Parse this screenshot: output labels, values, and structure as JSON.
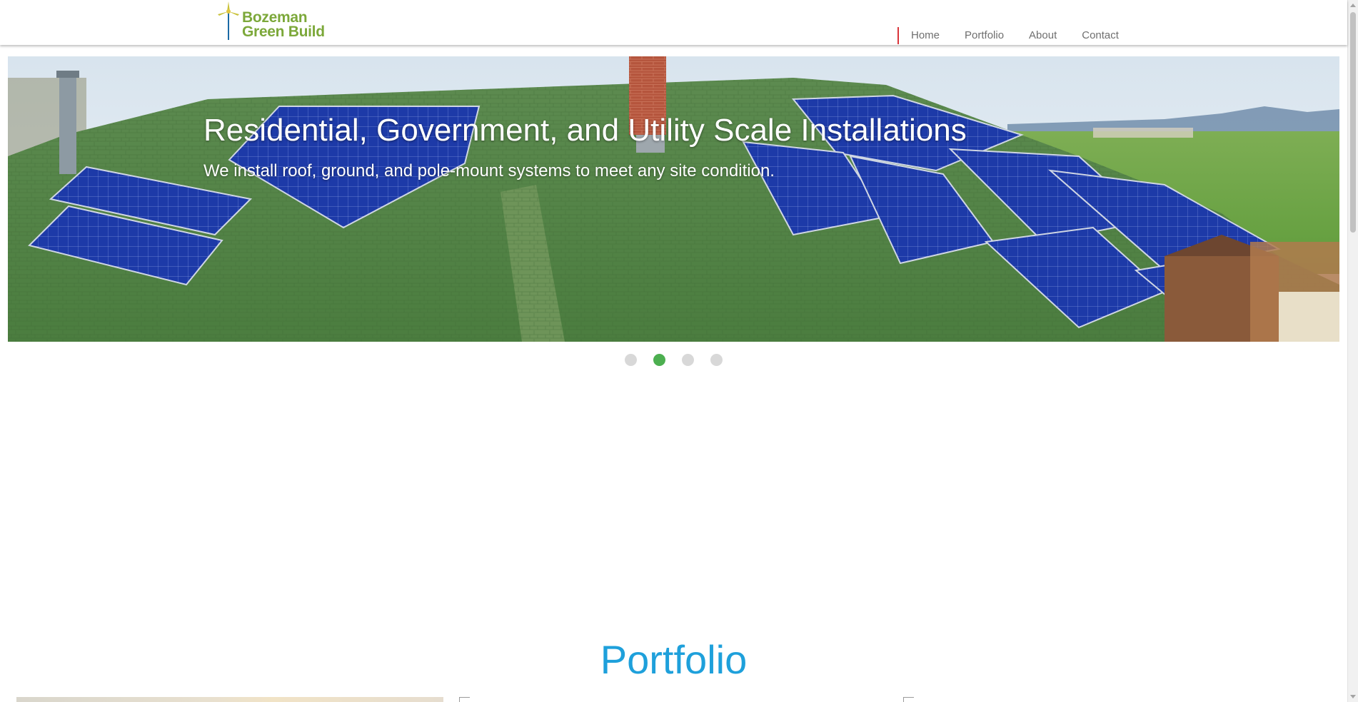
{
  "header": {
    "logo": {
      "line1": "Bozeman",
      "line2": "Green Build",
      "color": "#7ca83a",
      "icon": "wind-turbine-icon"
    },
    "nav": {
      "marker_color": "#d9343a",
      "items": [
        {
          "label": "Home"
        },
        {
          "label": "Portfolio"
        },
        {
          "label": "About"
        },
        {
          "label": "Contact"
        }
      ]
    }
  },
  "hero": {
    "title": "Residential, Government, and Utility Scale Installations",
    "subtitle": "We install roof, ground, and pole-mount systems to meet any site condition.",
    "image": "solar-panels-roof-photo",
    "slides": 4,
    "active_slide": 2,
    "active_dot_color": "#4caf50"
  },
  "portfolio": {
    "title": "Portfolio",
    "title_color": "#1ea0db"
  }
}
